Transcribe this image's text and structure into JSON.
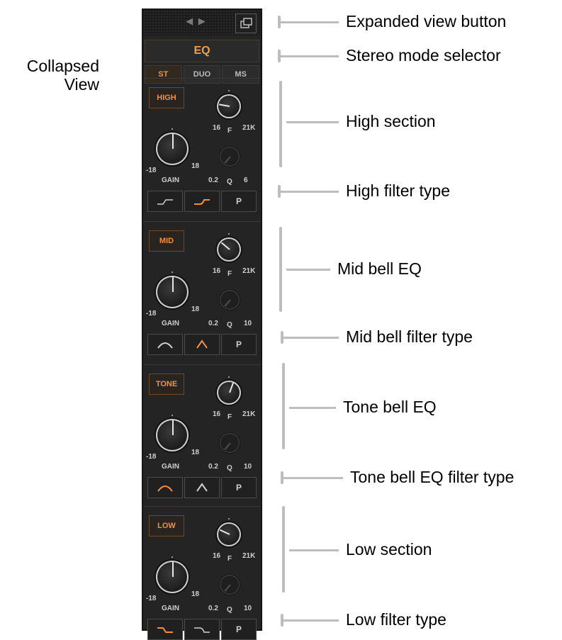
{
  "side_caption": {
    "line1": "Collapsed",
    "line2": "View"
  },
  "strip": {
    "nav_arrows": "◀ ▶",
    "title": "EQ",
    "modes": [
      {
        "label": "ST",
        "active": true
      },
      {
        "label": "DUO",
        "active": false
      },
      {
        "label": "MS",
        "active": false
      }
    ],
    "sections": [
      {
        "button": "HIGH",
        "freq_min": "16",
        "freq_mid": "F",
        "freq_max": "21K",
        "gain_min": "-18",
        "gain_max": "18",
        "gain_label": "GAIN",
        "q_min": "0.2",
        "q_label": "Q",
        "q_max": "6",
        "p_label": "P",
        "filter_icons": [
          "shelf-soft-icon",
          "shelf-steep-icon"
        ],
        "active_filter": 1
      },
      {
        "button": "MID",
        "freq_min": "16",
        "freq_mid": "F",
        "freq_max": "21K",
        "gain_min": "-18",
        "gain_max": "18",
        "gain_label": "GAIN",
        "q_min": "0.2",
        "q_label": "Q",
        "q_max": "10",
        "p_label": "P",
        "filter_icons": [
          "bell-wide-icon",
          "bell-narrow-icon"
        ],
        "active_filter": 1
      },
      {
        "button": "TONE",
        "freq_min": "16",
        "freq_mid": "F",
        "freq_max": "21K",
        "gain_min": "-18",
        "gain_max": "18",
        "gain_label": "GAIN",
        "q_min": "0.2",
        "q_label": "Q",
        "q_max": "10",
        "p_label": "P",
        "filter_icons": [
          "bell-wide-icon",
          "bell-narrow-icon"
        ],
        "active_filter": 0
      },
      {
        "button": "LOW",
        "freq_min": "16",
        "freq_mid": "F",
        "freq_max": "21K",
        "gain_min": "-18",
        "gain_max": "18",
        "gain_label": "GAIN",
        "q_min": "0.2",
        "q_label": "Q",
        "q_max": "10",
        "p_label": "P",
        "filter_icons": [
          "low-shelf-soft-icon",
          "low-shelf-steep-icon"
        ],
        "active_filter": 0
      }
    ],
    "accent_color": "#f09040"
  },
  "annotations": [
    {
      "label": "Expanded view button"
    },
    {
      "label": "Stereo mode selector"
    },
    {
      "label": "High section"
    },
    {
      "label": "High filter type"
    },
    {
      "label": "Mid bell EQ"
    },
    {
      "label": "Mid bell filter type"
    },
    {
      "label": "Tone bell EQ"
    },
    {
      "label": "Tone bell EQ filter type"
    },
    {
      "label": "Low section"
    },
    {
      "label": "Low filter type"
    }
  ]
}
